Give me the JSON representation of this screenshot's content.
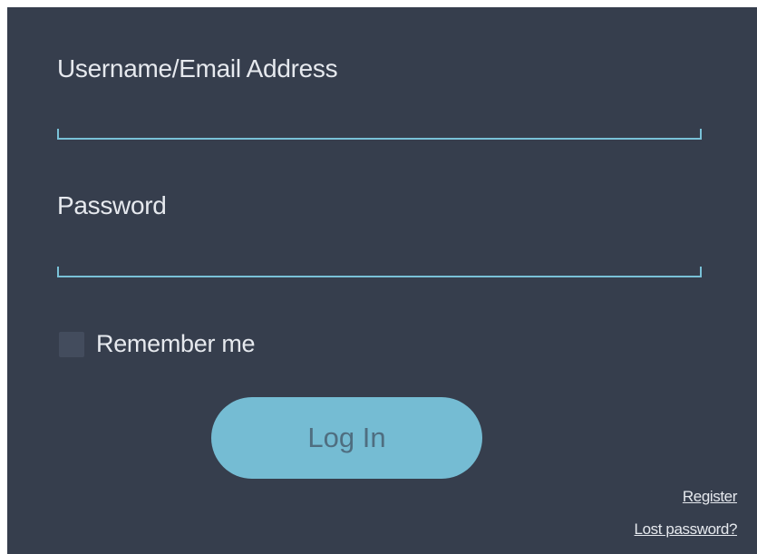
{
  "login_form": {
    "username_label": "Username/Email Address",
    "username_value": "",
    "username_placeholder": "",
    "password_label": "Password",
    "password_value": "",
    "password_placeholder": "",
    "remember_label": "Remember me",
    "remember_checked": false,
    "login_button_label": "Log In",
    "register_link": "Register",
    "lost_password_link": "Lost password?"
  },
  "colors": {
    "panel_background": "#363e4d",
    "accent": "#75bcd3",
    "input_underline": "#79c1d7",
    "text": "#e6e9ee"
  }
}
